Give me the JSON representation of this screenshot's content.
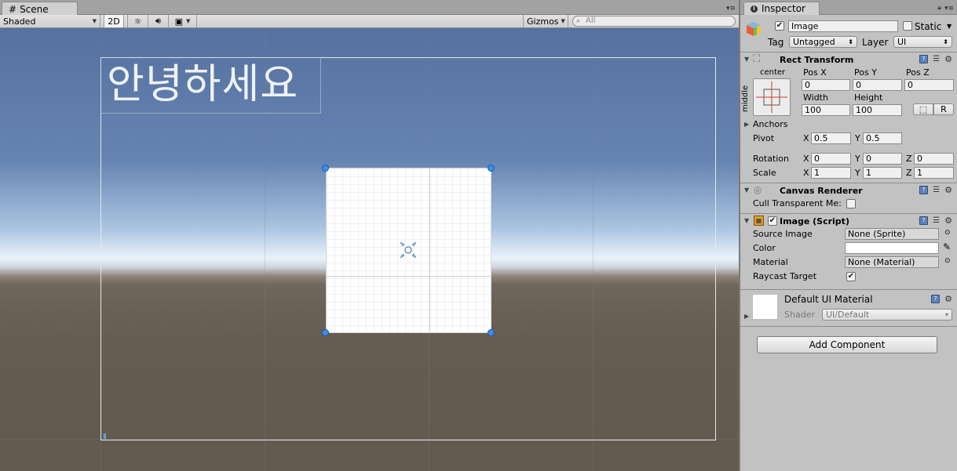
{
  "scene": {
    "tab_label": "Scene",
    "shading_mode": "Shaded",
    "mode_2d": "2D",
    "gizmos_label": "Gizmos",
    "search_placeholder": "All",
    "canvas_text": "안녕하세요"
  },
  "inspector": {
    "tab_label": "Inspector",
    "object_name": "Image",
    "active_checked": true,
    "static_label": "Static",
    "static_checked": false,
    "tag_label": "Tag",
    "tag_value": "Untagged",
    "layer_label": "Layer",
    "layer_value": "UI",
    "rect_transform": {
      "title": "Rect Transform",
      "anchor_h": "center",
      "anchor_v": "middle",
      "pos_x_label": "Pos X",
      "pos_y_label": "Pos Y",
      "pos_z_label": "Pos Z",
      "pos_x": "0",
      "pos_y": "0",
      "pos_z": "0",
      "width_label": "Width",
      "height_label": "Height",
      "width": "100",
      "height": "100",
      "raw_edit_label": "R",
      "anchors_label": "Anchors",
      "pivot_label": "Pivot",
      "pivot_x": "0.5",
      "pivot_y": "0.5",
      "rotation_label": "Rotation",
      "rot_x": "0",
      "rot_y": "0",
      "rot_z": "0",
      "scale_label": "Scale",
      "scale_x": "1",
      "scale_y": "1",
      "scale_z": "1",
      "x": "X",
      "y": "Y",
      "z": "Z"
    },
    "canvas_renderer": {
      "title": "Canvas Renderer",
      "cull_label": "Cull Transparent Me:"
    },
    "image_script": {
      "title": "Image (Script)",
      "enabled": true,
      "source_image_label": "Source Image",
      "source_image_value": "None (Sprite)",
      "color_label": "Color",
      "color_value": "#ffffff",
      "material_label": "Material",
      "material_value": "None (Material)",
      "raycast_label": "Raycast Target",
      "raycast_checked": true
    },
    "material": {
      "title": "Default UI Material",
      "shader_label": "Shader",
      "shader_value": "UI/Default"
    },
    "add_component_label": "Add Component"
  }
}
